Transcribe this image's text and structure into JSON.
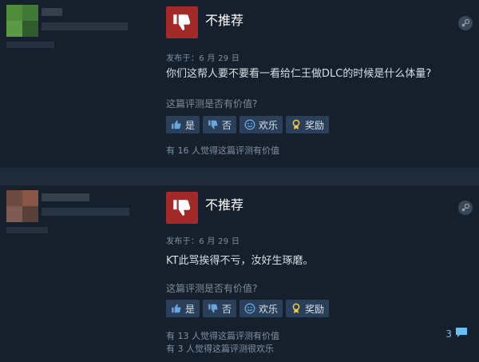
{
  "reviews": [
    {
      "verdict": "不推荐",
      "posted": "发布于：6 月 29 日",
      "content": "你们这帮人要不要看一看给仁王做DLC的时候是什么体量?",
      "helpful_question": "这篇评测是否有价值?",
      "buttons": {
        "yes": "是",
        "no": "否",
        "funny": "欢乐",
        "award": "奖励"
      },
      "vote_info": [
        "有 16 人觉得这篇评测有价值"
      ],
      "comment_count": ""
    },
    {
      "verdict": "不推荐",
      "posted": "发布于：6 月 29 日",
      "content": "KT此骂挨得不亏，汝好生琢磨。",
      "helpful_question": "这篇评测是否有价值?",
      "buttons": {
        "yes": "是",
        "no": "否",
        "funny": "欢乐",
        "award": "奖励"
      },
      "vote_info": [
        "有 13 人觉得这篇评测有价值",
        "有 3 人觉得这篇评测很欢乐"
      ],
      "comment_count": "3"
    }
  ],
  "colors": {
    "background": "#1b2838",
    "review_bg": "#16202d",
    "thumb_down": "#a42a2a",
    "vote_button": "#2a3f5a",
    "link": "#66c0f4"
  }
}
